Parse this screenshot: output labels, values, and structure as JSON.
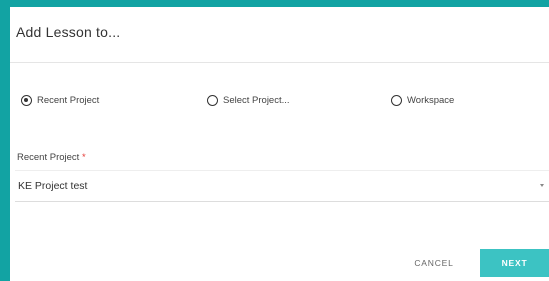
{
  "dialog": {
    "title": "Add Lesson to..."
  },
  "radio_options": [
    {
      "label": "Recent Project",
      "checked": true
    },
    {
      "label": "Select Project...",
      "checked": false
    },
    {
      "label": "Workspace",
      "checked": false
    }
  ],
  "recent_project_field": {
    "label": "Recent Project",
    "required_marker": "*",
    "selected_value": "KE Project test"
  },
  "actions": {
    "cancel_label": "CANCEL",
    "next_label": "NEXT"
  },
  "colors": {
    "background_teal": "#12a3a3",
    "next_button": "#3cc3c3",
    "required_red": "#e53935"
  }
}
